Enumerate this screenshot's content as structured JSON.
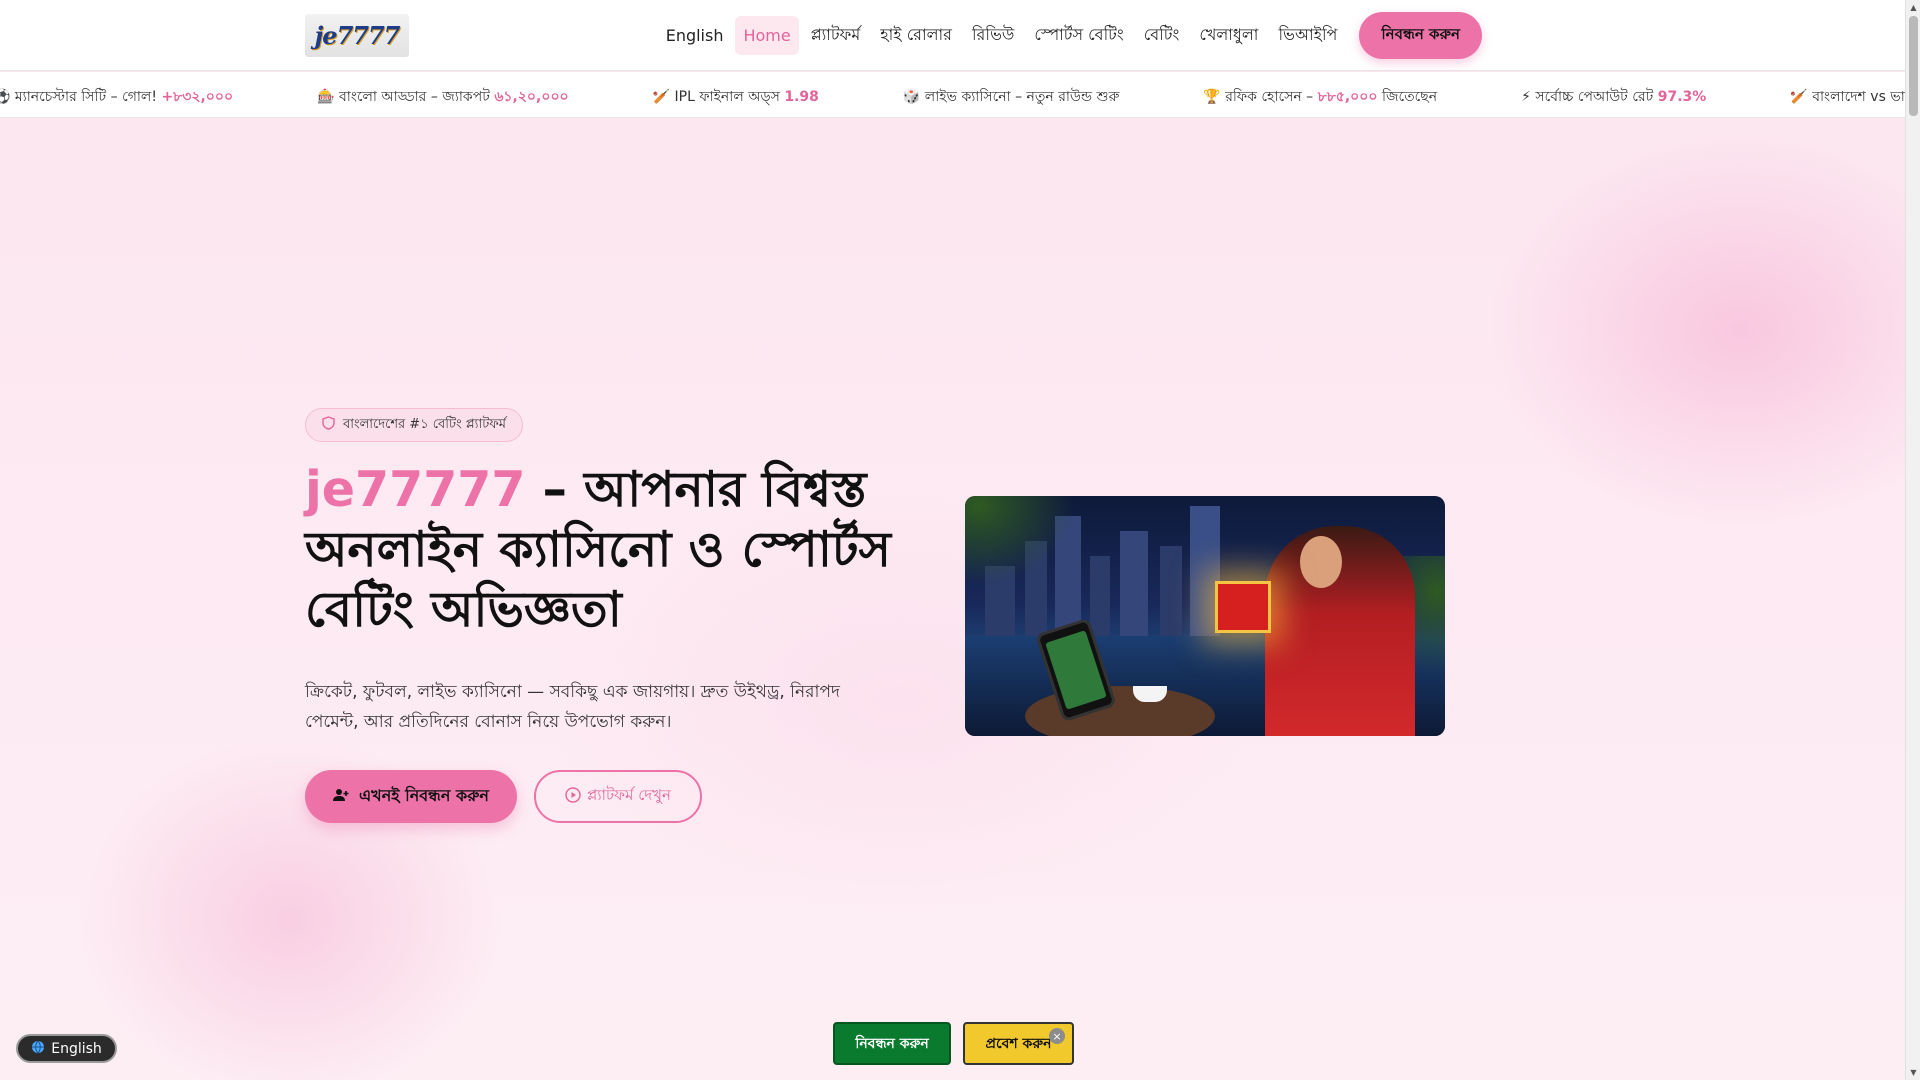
{
  "header": {
    "logo_text": "je7777",
    "nav": [
      {
        "label": "English"
      },
      {
        "label": "Home",
        "active": true
      },
      {
        "label": "প্ল্যাটফর্ম"
      },
      {
        "label": "হাই রোলার"
      },
      {
        "label": "রিভিউ"
      },
      {
        "label": "স্পোর্টস বেটিং"
      },
      {
        "label": "বেটিং"
      },
      {
        "label": "খেলাধুলা"
      },
      {
        "label": "ভিআইপি"
      }
    ],
    "cta": "নিবন্ধন করুন"
  },
  "ticker": [
    {
      "text": "⚽ ম্যানচেস্টার সিটি – গোল! ",
      "highlight": "+৮৩২,০০০"
    },
    {
      "text": "🎰 বাংলো আড্ডার – জ্যাকপট ",
      "highlight": "৬১,২০,০০০"
    },
    {
      "text": "🏏 IPL ফাইনাল অড্স ",
      "highlight": "1.98"
    },
    {
      "text": "🎲 লাইভ ক্যাসিনো – নতুন রাউন্ড শুরু",
      "highlight": ""
    },
    {
      "text": "🏆 রফিক হোসেন – ",
      "highlight": "৮৮৫,০০০",
      "suffix": " জিতেছেন"
    },
    {
      "text": "⚡ সর্বোচ্চ পেআউট রেট ",
      "highlight": "97.3%"
    },
    {
      "text": "🏏 বাংলাদেশ vs ভারত – লাইভ অড্স",
      "highlight": ""
    }
  ],
  "hero": {
    "badge": "বাংলাদেশের #১ বেটিং প্ল্যাটফর্ম",
    "title_brand": "je77777",
    "title_rest": " – আপনার বিশ্বস্ত অনলাইন ক্যাসিনো ও স্পোর্টস বেটিং অভিজ্ঞতা",
    "subtitle": "ক্রিকেট, ফুটবল, লাইভ ক্যাসিনো — সবকিছু এক জায়গায়। দ্রুত উইথড্র, নিরাপদ পেমেন্ট, আর প্রতিদিনের বোনাস নিয়ে উপভোগ করুন।",
    "primary_button": "এখনই নিবন্ধন করুন",
    "secondary_button": "প্ল্যাটফর্ম দেখুন"
  },
  "bottom_bar": {
    "language": "English",
    "register": "নিবন্ধন করুন",
    "login": "প্রবেশ করুন",
    "close": "×"
  },
  "colors": {
    "accent_pink": "#ec72a8",
    "register_green": "#0a7a2f",
    "login_yellow": "#f2c92c"
  },
  "icons": {
    "badge": "shield-icon",
    "primary_button": "user-plus-icon",
    "secondary_button": "play-circle-icon",
    "language": "globe-icon"
  }
}
